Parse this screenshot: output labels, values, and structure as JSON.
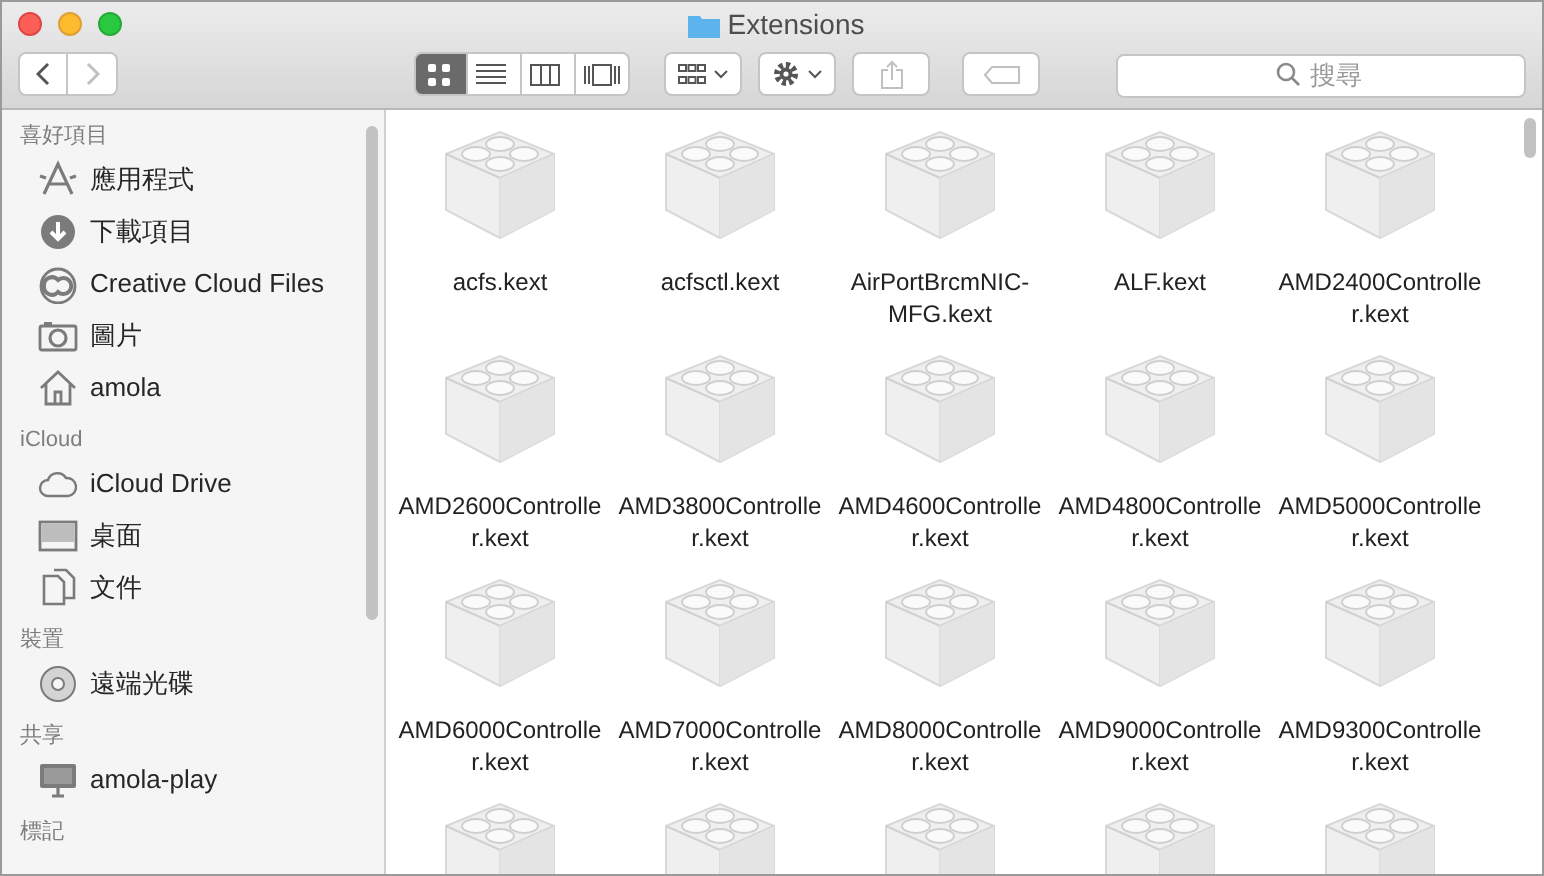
{
  "window": {
    "title": "Extensions"
  },
  "toolbar": {
    "back": {
      "disabled": false
    },
    "forward": {
      "disabled": true
    },
    "view_modes": [
      {
        "kind": "icons",
        "selected": true
      },
      {
        "kind": "list",
        "selected": false
      },
      {
        "kind": "columns",
        "selected": false
      },
      {
        "kind": "coverflow",
        "selected": false
      }
    ],
    "share": {
      "disabled": true
    },
    "tags": {
      "disabled": true
    },
    "search": {
      "placeholder": "搜尋"
    }
  },
  "sidebar": {
    "sections": [
      {
        "title": "喜好項目",
        "items": [
          {
            "label": "應用程式",
            "kind": "apps"
          },
          {
            "label": "下載項目",
            "kind": "download"
          },
          {
            "label": "Creative Cloud Files",
            "kind": "cc"
          },
          {
            "label": "圖片",
            "kind": "camera"
          },
          {
            "label": "amola",
            "kind": "home"
          }
        ]
      },
      {
        "title": "iCloud",
        "items": [
          {
            "label": "iCloud Drive",
            "kind": "cloud"
          },
          {
            "label": "桌面",
            "kind": "desktop"
          },
          {
            "label": "文件",
            "kind": "document"
          }
        ]
      },
      {
        "title": "裝置",
        "items": [
          {
            "label": "遠端光碟",
            "kind": "disc"
          }
        ]
      },
      {
        "title": "共享",
        "items": [
          {
            "label": "amola-play",
            "kind": "monitor"
          }
        ]
      },
      {
        "title": "標記"
      }
    ]
  },
  "files": [
    {
      "kind": "file",
      "name": "acfs.kext"
    },
    {
      "kind": "file",
      "name": "acfsctl.kext"
    },
    {
      "kind": "file",
      "name": "AirPortBrcmNIC-MFG.kext"
    },
    {
      "kind": "file",
      "name": "ALF.kext"
    },
    {
      "kind": "file",
      "name": "AMD2400Controller.kext"
    },
    {
      "kind": "file",
      "name": "AMD2600Controller.kext"
    },
    {
      "kind": "file",
      "name": "AMD3800Controller.kext"
    },
    {
      "kind": "file",
      "name": "AMD4600Controller.kext"
    },
    {
      "kind": "file",
      "name": "AMD4800Controller.kext"
    },
    {
      "kind": "file",
      "name": "AMD5000Controller.kext"
    },
    {
      "kind": "file",
      "name": "AMD6000Controller.kext"
    },
    {
      "kind": "file",
      "name": "AMD7000Controller.kext"
    },
    {
      "kind": "file",
      "name": "AMD8000Controller.kext"
    },
    {
      "kind": "file",
      "name": "AMD9000Controller.kext"
    },
    {
      "kind": "file",
      "name": "AMD9300Controller.kext"
    },
    {
      "kind": "cut_off"
    },
    {
      "kind": "cut_off"
    },
    {
      "kind": "cut_off"
    },
    {
      "kind": "cut_off"
    },
    {
      "kind": "cut_off"
    }
  ]
}
